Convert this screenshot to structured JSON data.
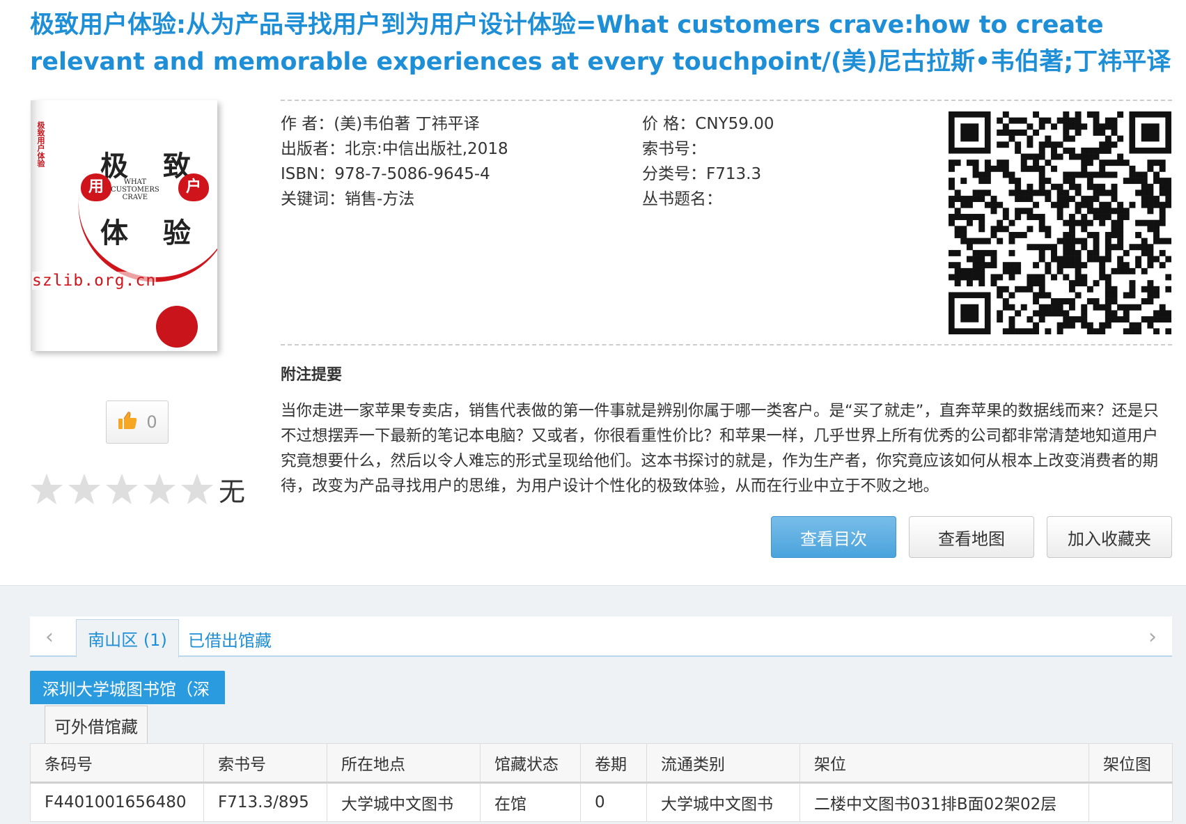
{
  "title": "极致用户体验:从为产品寻找用户到为用户设计体验=What customers crave:how to create relevant and memorable experiences at every touchpoint/(美)尼古拉斯•韦伯著;丁祎平译",
  "cover": {
    "spine_text": "极致用户体验",
    "line1": "极 致",
    "line2": "体 验",
    "heart_left": "用",
    "heart_right": "户",
    "what": "WHAT",
    "customers": "CUSTOMERS",
    "crave": "CRAVE",
    "watermark": "szlib.org.cn"
  },
  "like": {
    "count": "0"
  },
  "rating": {
    "text": "无",
    "stars": 0,
    "max": 5
  },
  "meta_left": {
    "author": "作 者：(美)韦伯著  丁祎平译",
    "publisher": "出版者：北京:中信出版社,2018",
    "isbn": "ISBN：978-7-5086-9645-4",
    "keywords": "关键词：销售-方法"
  },
  "meta_right": {
    "price": "价 格：CNY59.00",
    "call_number": "索书号：",
    "classification": "分类号：F713.3",
    "series": "丛书题名："
  },
  "notes": {
    "title": "附注提要",
    "body": "当你走进一家苹果专卖店，销售代表做的第一件事就是辨别你属于哪一类客户。是“买了就走”，直奔苹果的数据线而来？还是只不过想摆弄一下最新的笔记本电脑？又或者，你很看重性价比？和苹果一样，几乎世界上所有优秀的公司都非常清楚地知道用户究竟想要什么，然后以令人难忘的形式呈现给他们。这本书探讨的就是，作为生产者，你究竟应该如何从根本上改变消费者的期待，改变为产品寻找用户的思维，为用户设计个性化的极致体验，从而在行业中立于不败之地。"
  },
  "buttons": {
    "toc": "查看目次",
    "map": "查看地图",
    "favorite": "加入收藏夹"
  },
  "tabs": {
    "nanshan": "南山区 (1)",
    "borrowed": "已借出馆藏"
  },
  "library_tab": "深圳大学城图书馆（深",
  "sub_tab": "可外借馆藏",
  "table": {
    "headers": [
      "条码号",
      "索书号",
      "所在地点",
      "馆藏状态",
      "卷期",
      "流通类别",
      "架位",
      "架位图"
    ],
    "rows": [
      [
        "F4401001656480",
        "F713.3/895",
        "大学城中文图书",
        "在馆",
        "0",
        "大学城中文图书",
        "二楼中文图书031排B面02架02层",
        ""
      ]
    ]
  },
  "colors": {
    "accent": "#1e8fd6",
    "primary_button": "#4aa3dc",
    "cover_red": "#d0141b",
    "lower_bg": "#eef2f5"
  },
  "icons": {
    "like": "thumbs-up-icon",
    "star": "star-icon",
    "prev": "chevron-left-icon",
    "next": "chevron-right-icon",
    "qr": "qr-code-icon"
  }
}
